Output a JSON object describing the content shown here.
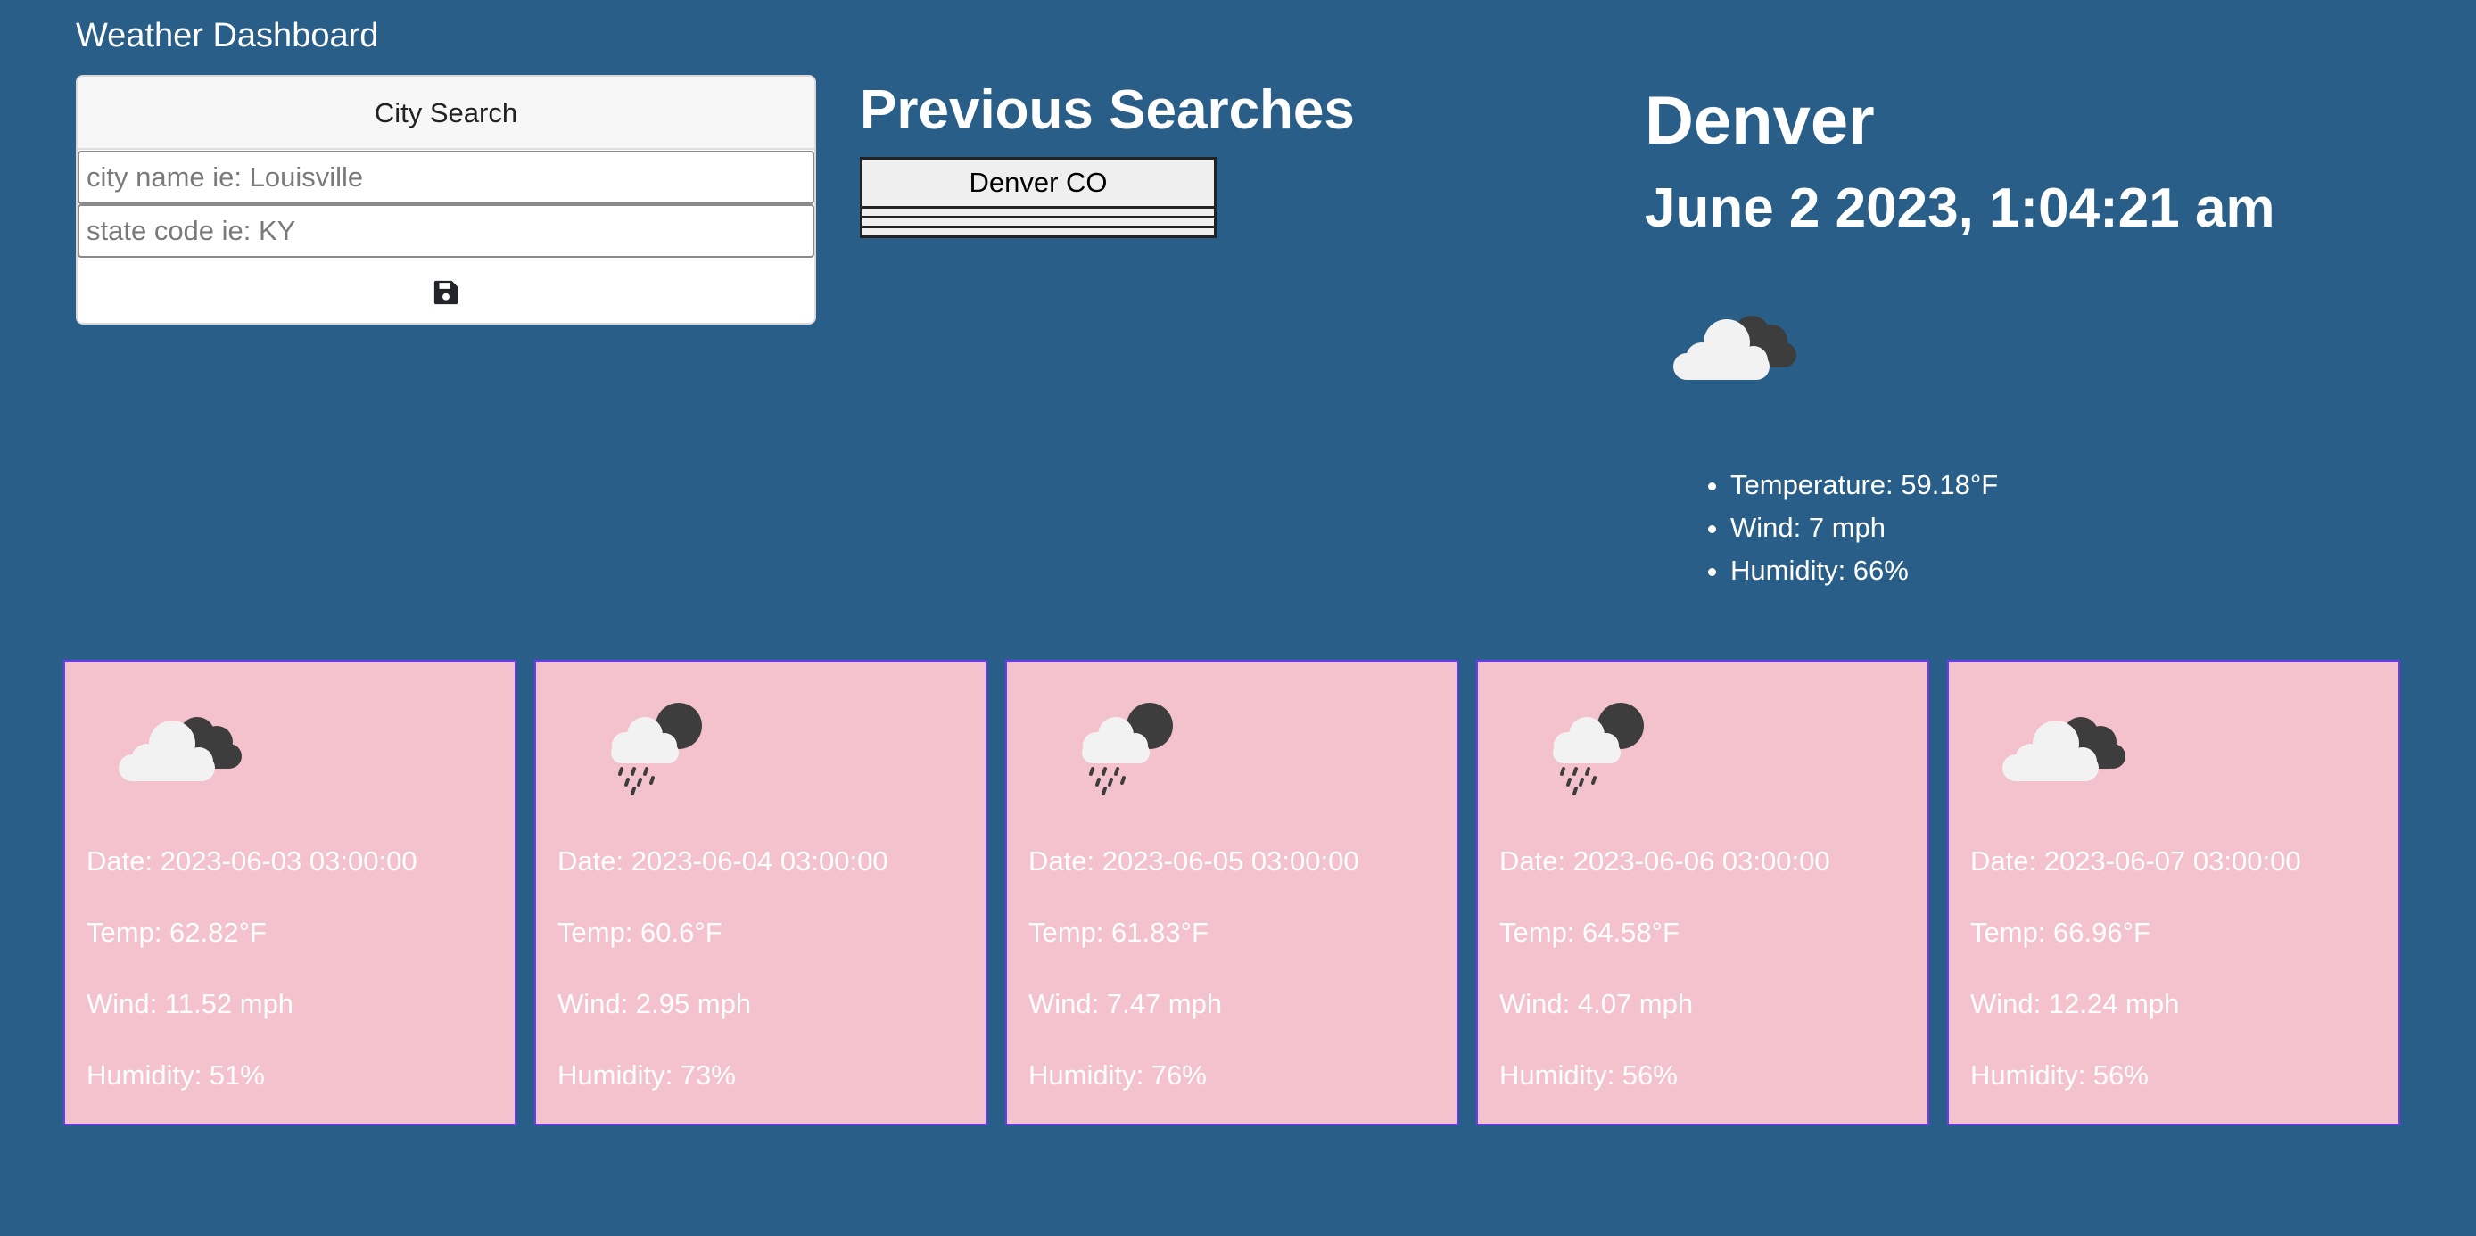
{
  "app": {
    "title": "Weather Dashboard"
  },
  "search": {
    "header": "City Search",
    "city_placeholder": "city name ie: Louisville",
    "state_placeholder": "state code ie: KY",
    "save_icon": "floppy-disk-icon"
  },
  "previous_searches": {
    "title": "Previous Searches",
    "items": [
      "Denver CO"
    ]
  },
  "current": {
    "city": "Denver",
    "datetime": "June 2 2023, 1:04:21 am",
    "icon": "broken-clouds-icon",
    "temperature": "Temperature: 59.18°F",
    "wind": "Wind: 7 mph",
    "humidity": "Humidity: 66%"
  },
  "forecast": [
    {
      "icon": "broken-clouds-icon",
      "date": "Date: 2023-06-03 03:00:00",
      "temp": "Temp: 62.82°F",
      "wind": "Wind: 11.52 mph",
      "humidity": "Humidity: 51%"
    },
    {
      "icon": "rain-night-icon",
      "date": "Date: 2023-06-04 03:00:00",
      "temp": "Temp: 60.6°F",
      "wind": "Wind: 2.95 mph",
      "humidity": "Humidity: 73%"
    },
    {
      "icon": "rain-night-icon",
      "date": "Date: 2023-06-05 03:00:00",
      "temp": "Temp: 61.83°F",
      "wind": "Wind: 7.47 mph",
      "humidity": "Humidity: 76%"
    },
    {
      "icon": "rain-night-icon",
      "date": "Date: 2023-06-06 03:00:00",
      "temp": "Temp: 64.58°F",
      "wind": "Wind: 4.07 mph",
      "humidity": "Humidity: 56%"
    },
    {
      "icon": "broken-clouds-icon",
      "date": "Date: 2023-06-07 03:00:00",
      "temp": "Temp: 66.96°F",
      "wind": "Wind: 12.24 mph",
      "humidity": "Humidity: 56%"
    }
  ],
  "colors": {
    "page_background": "#285e87",
    "card_background": "#f3c2cc",
    "card_border": "#6a3ef0"
  }
}
